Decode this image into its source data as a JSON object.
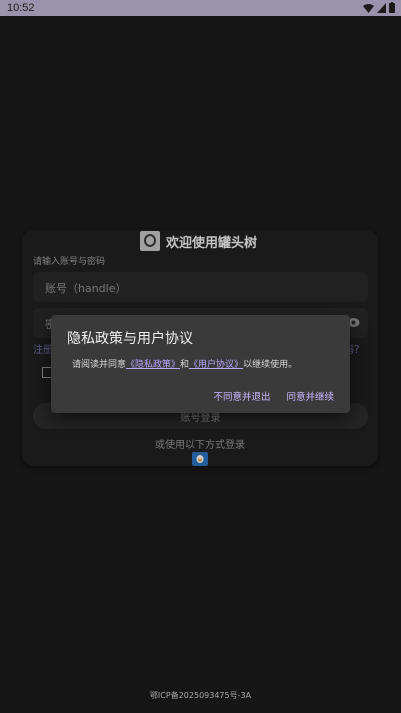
{
  "status_bar": {
    "time": "10:52"
  },
  "card": {
    "title": "欢迎使用罐头树",
    "hint": "请输入账号与密码",
    "handle_placeholder": "账号（handle）",
    "password_placeholder_partial": "密",
    "link_left_partial": "注册",
    "link_right_partial": "码？",
    "login_button": "账号登录",
    "other_login": "或使用以下方式登录"
  },
  "dialog": {
    "title": "隐私政策与用户协议",
    "body_prefix": "请阅读并同意",
    "privacy_link": "《隐私政策》",
    "and": "和",
    "user_link": "《用户协议》",
    "body_suffix": "以继续使用。",
    "decline": "不同意并退出",
    "accept": "同意并继续"
  },
  "footer": {
    "icp": "鄂ICP备2025093475号-3A"
  },
  "colors": {
    "accent": "#cbb9ff",
    "background": "#1a1a1a",
    "dialog": "#3a3a3a",
    "statusbar": "#9b92ad"
  }
}
